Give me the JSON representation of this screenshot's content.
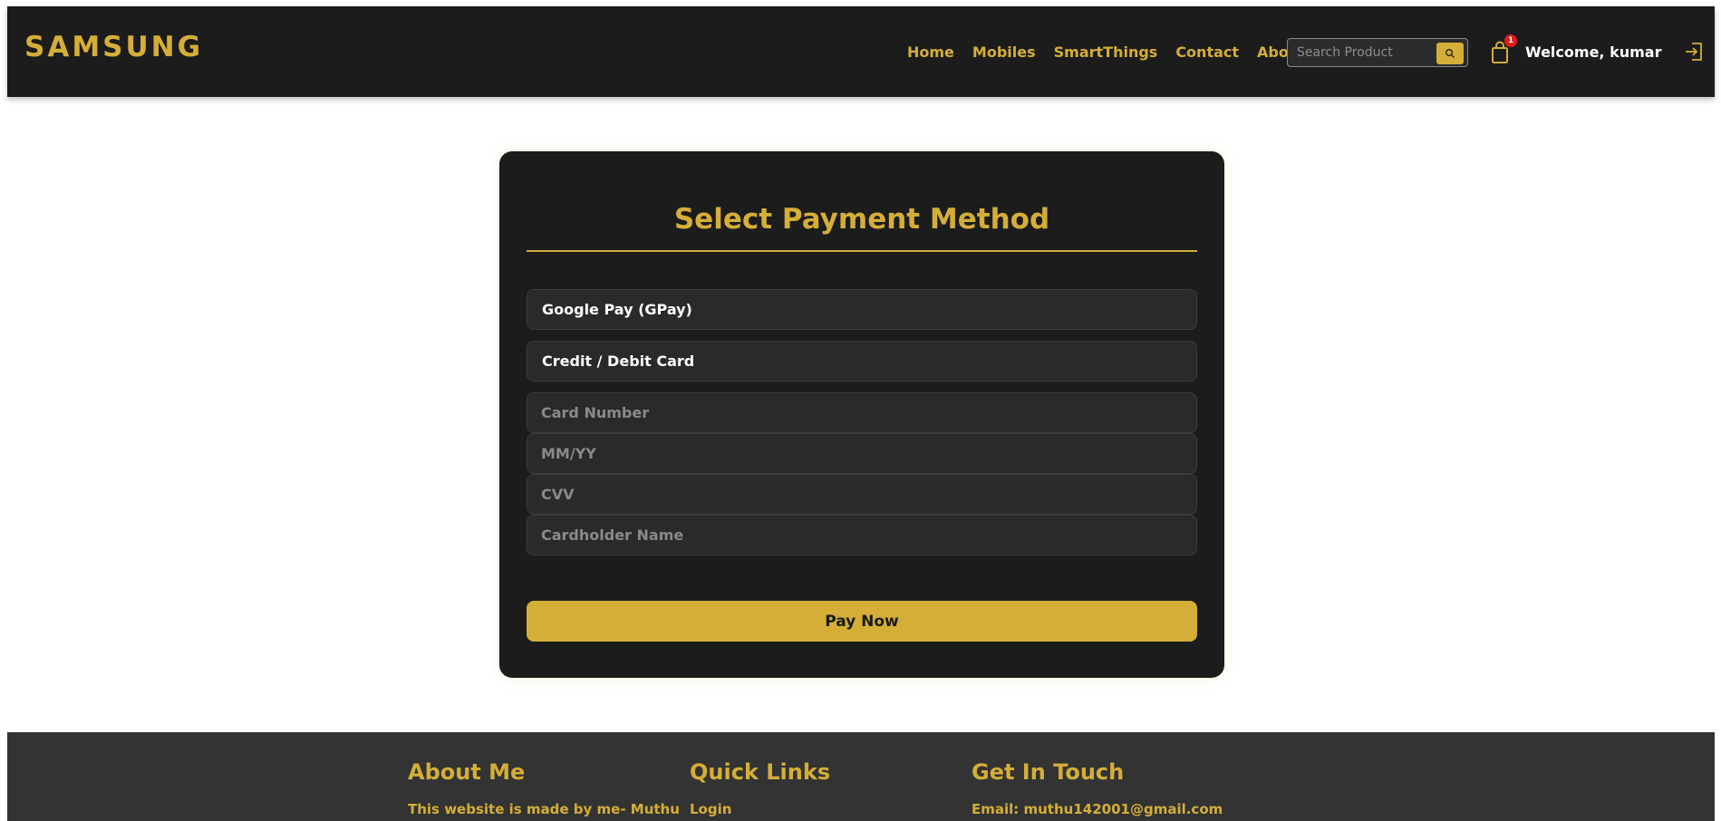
{
  "header": {
    "logo": "SAMSUNG",
    "nav": [
      "Home",
      "Mobiles",
      "SmartThings",
      "Contact",
      "About"
    ],
    "search_placeholder": "Search Product",
    "cart_count": "1",
    "welcome": "Welcome, kumar"
  },
  "payment": {
    "title": "Select Payment Method",
    "methods": [
      "Google Pay (GPay)",
      "Credit / Debit Card"
    ],
    "fields": {
      "card_number": "Card Number",
      "expiry": "MM/YY",
      "cvv": "CVV",
      "cardholder": "Cardholder Name"
    },
    "pay_button": "Pay Now"
  },
  "footer": {
    "about_heading": "About Me",
    "about_text": "This website is made by me- Muthu",
    "links_heading": "Quick Links",
    "links": [
      "Login"
    ],
    "contact_heading": "Get In Touch",
    "email": "Email: muthu142001@gmail.com"
  },
  "colors": {
    "accent": "#d4ae37",
    "header_bg": "#1c1c1c",
    "footer_bg": "#333333",
    "badge": "#e11b1b"
  }
}
